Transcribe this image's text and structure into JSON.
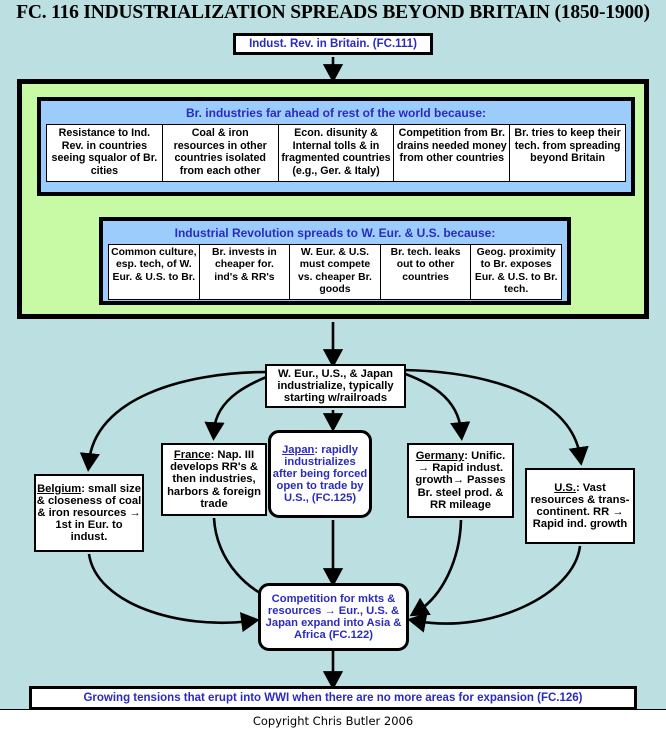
{
  "title": "FC. 116 INDUSTRIALIZATION SPREADS BEYOND BRITAIN (1850-1900)",
  "footer": "Copyright Chris Butler 2006",
  "colors": {
    "background": "#bcdfe1",
    "green_panel": "#c8f9a4",
    "blue_panel": "#9cccfc",
    "node_text_blue": "#2b2bbe",
    "node_text_black": "#000000",
    "node_fill": "#ffffff",
    "outline": "#000000"
  },
  "nodes": {
    "britain": "Indust. Rev. in Britain. (FC.111)",
    "main": "W. Eur., U.S., & Japan industrialize, typically starting w/railroads",
    "competition": "Competition for mkts & resources → Eur., U.S. & Japan expand into Asia & Africa (FC.122)",
    "wwi": "Growing tensions that erupt into WWI when there are no more areas for expansion (FC.126)"
  },
  "panel_one": {
    "heading": "Br. industries far ahead of rest of the world because:",
    "cells": [
      "Resistance to Ind. Rev. in countries seeing squalor of Br. cities",
      "Coal & iron resources in other countries isolated from each other",
      "Econ. disunity & Internal tolls & in fragmented countries (e.g., Ger. & Italy)",
      "Competition from Br. drains needed money from other countries",
      "Br. tries to keep their tech. from spreading beyond Britain"
    ]
  },
  "panel_two": {
    "heading": "Industrial Revolution spreads to W. Eur. & U.S. because:",
    "cells": [
      "Common culture, esp. tech, of W. Eur. & U.S. to Br.",
      "Br. invests in cheaper for. ind's & RR's",
      "W. Eur. & U.S. must compete vs. cheaper Br. goods",
      "Br. tech. leaks out to other countries",
      "Geog. proximity to Br. exposes Eur. & U.S. to Br. tech."
    ]
  },
  "countries": {
    "belgium": {
      "name": "Belgium",
      "text": ": small size & closeness of coal & iron resources → 1st in Eur. to indust."
    },
    "france": {
      "name": "France",
      "text": ": Nap. III develops RR's & then industries, harbors & foreign trade"
    },
    "japan": {
      "name": "Japan",
      "text": ": rapidly industrializes after being forced open to trade by U.S., (FC.125)"
    },
    "germany": {
      "name": "Germany",
      "text": ": Unific. → Rapid indust. growth→ Passes Br. steel prod. & RR mileage"
    },
    "us": {
      "name": "U.S.",
      "text": ": Vast resources & trans-continent. RR → Rapid ind. growth"
    }
  },
  "icons": {
    "arrowhead": "arrowhead-icon"
  }
}
